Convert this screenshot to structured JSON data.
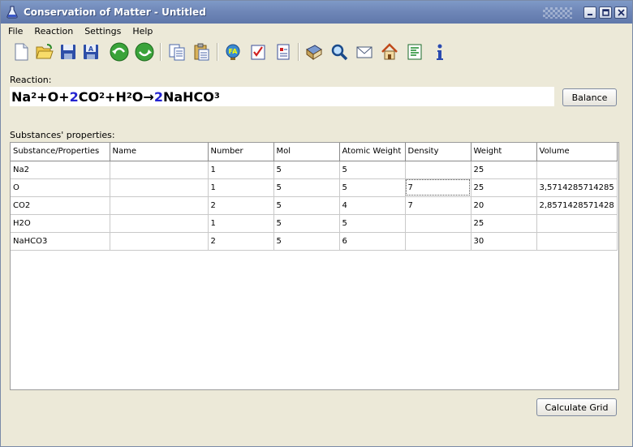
{
  "window": {
    "title": "Conservation of Matter - Untitled"
  },
  "menu": [
    "File",
    "Reaction",
    "Settings",
    "Help"
  ],
  "toolbar": {
    "icons": [
      "new-file-icon",
      "open-folder-icon",
      "save-icon",
      "save-as-icon",
      "undo-icon",
      "redo-icon",
      "copy-icon",
      "paste-icon",
      "atom-icon",
      "checklist-icon",
      "report-icon",
      "book-icon",
      "search-icon",
      "mail-icon",
      "home-icon",
      "notes-icon",
      "info-icon"
    ]
  },
  "reaction": {
    "label": "Reaction:",
    "parts": [
      {
        "t": "Na"
      },
      {
        "sub": "2"
      },
      {
        "t": "+O+"
      },
      {
        "coef": "2"
      },
      {
        "t": "CO"
      },
      {
        "sub": "2"
      },
      {
        "t": "+H"
      },
      {
        "sub": "2"
      },
      {
        "t": "O"
      },
      {
        "t": "→ "
      },
      {
        "coef": "2"
      },
      {
        "t": "NaHCO"
      },
      {
        "sub": "3"
      }
    ],
    "balance_label": "Balance"
  },
  "properties": {
    "label": "Substances' properties:",
    "columns": [
      "Substance/Properties",
      "Name",
      "Number",
      "Mol",
      "Atomic Weight",
      "Density",
      "Weight",
      "Volume"
    ],
    "rows": [
      [
        "Na2",
        "",
        "1",
        "5",
        "5",
        "",
        "25",
        ""
      ],
      [
        "O",
        "",
        "1",
        "5",
        "5",
        "7",
        "25",
        "3,5714285714285"
      ],
      [
        "CO2",
        "",
        "2",
        "5",
        "4",
        "7",
        "20",
        "2,8571428571428"
      ],
      [
        "H2O",
        "",
        "1",
        "5",
        "5",
        "",
        "25",
        ""
      ],
      [
        "NaHCO3",
        "",
        "2",
        "5",
        "6",
        "",
        "30",
        ""
      ]
    ]
  },
  "calculate_label": "Calculate Grid",
  "colors": {
    "titlebar": "#6f87b8",
    "coefficient": "#2424d0",
    "window_bg": "#ece9d8"
  }
}
